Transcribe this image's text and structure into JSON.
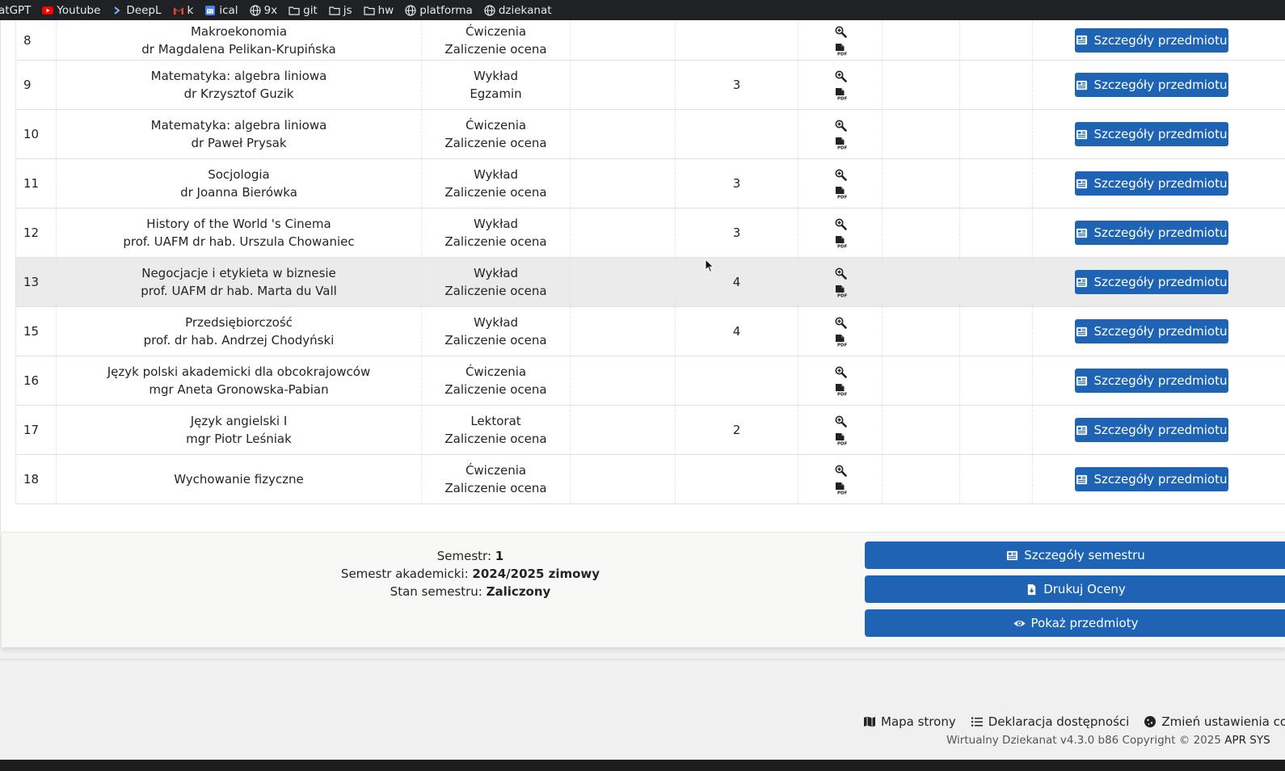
{
  "bookmarks": [
    {
      "label": "atGPT",
      "icon": "none"
    },
    {
      "label": "Youtube",
      "icon": "youtube-icon"
    },
    {
      "label": "DeepL",
      "icon": "deepl-icon"
    },
    {
      "label": "k",
      "icon": "gmail-icon"
    },
    {
      "label": "ical",
      "icon": "calendar-icon"
    },
    {
      "label": "9x",
      "icon": "globe-icon"
    },
    {
      "label": "git",
      "icon": "folder-icon"
    },
    {
      "label": "js",
      "icon": "folder-icon"
    },
    {
      "label": "hw",
      "icon": "folder-icon"
    },
    {
      "label": "platforma",
      "icon": "globe-icon"
    },
    {
      "label": "dziekanat",
      "icon": "globe-icon"
    }
  ],
  "table": {
    "details_label": "Szczegóły przedmiotu",
    "rows": [
      {
        "num": "8",
        "subject": "Makroekonomia",
        "teacher": "dr Magdalena Pelikan-Krupińska",
        "form": "Ćwiczenia",
        "assessment": "Zaliczenie ocena",
        "ects": ""
      },
      {
        "num": "9",
        "subject": "Matematyka: algebra liniowa",
        "teacher": "dr Krzysztof Guzik",
        "form": "Wykład",
        "assessment": "Egzamin",
        "ects": "3"
      },
      {
        "num": "10",
        "subject": "Matematyka: algebra liniowa",
        "teacher": "dr Paweł Prysak",
        "form": "Ćwiczenia",
        "assessment": "Zaliczenie ocena",
        "ects": ""
      },
      {
        "num": "11",
        "subject": "Socjologia",
        "teacher": "dr Joanna Bierówka",
        "form": "Wykład",
        "assessment": "Zaliczenie ocena",
        "ects": "3"
      },
      {
        "num": "12",
        "subject": "History of the World 's Cinema",
        "teacher": "prof. UAFM dr hab. Urszula Chowaniec",
        "form": "Wykład",
        "assessment": "Zaliczenie ocena",
        "ects": "3"
      },
      {
        "num": "13",
        "subject": "Negocjacje i etykieta w biznesie",
        "teacher": "prof. UAFM dr hab. Marta du Vall",
        "form": "Wykład",
        "assessment": "Zaliczenie ocena",
        "ects": "4"
      },
      {
        "num": "15",
        "subject": "Przedsiębiorczość",
        "teacher": "prof. dr hab. Andrzej Chodyński",
        "form": "Wykład",
        "assessment": "Zaliczenie ocena",
        "ects": "4"
      },
      {
        "num": "16",
        "subject": "Język polski akademicki dla obcokrajowców",
        "teacher": "mgr Aneta Gronowska-Pabian",
        "form": "Ćwiczenia",
        "assessment": "Zaliczenie ocena",
        "ects": ""
      },
      {
        "num": "17",
        "subject": "Język angielski I",
        "teacher": "mgr Piotr Leśniak",
        "form": "Lektorat",
        "assessment": "Zaliczenie ocena",
        "ects": "2"
      },
      {
        "num": "18",
        "subject": "Wychowanie fizyczne",
        "teacher": "",
        "form": "Ćwiczenia",
        "assessment": "Zaliczenie ocena",
        "ects": ""
      }
    ]
  },
  "semester": {
    "semester_label": "Semestr:",
    "semester_value": "1",
    "academic_label": "Semestr akademicki:",
    "academic_value": "2024/2025 zimowy",
    "status_label": "Stan semestru:",
    "status_value": "Zaliczony",
    "buttons": {
      "details": "Szczegóły semestru",
      "print": "Drukuj Oceny",
      "show": "Pokaż przedmioty"
    }
  },
  "footer": {
    "sitemap": "Mapa strony",
    "accessibility": "Deklaracja dostępności",
    "cookies": "Zmień ustawienia coo",
    "copyright_prefix": "Wirtualny Dziekanat v4.3.0 b86 Copyright © 2025",
    "copyright_company": "APR SYS"
  },
  "colors": {
    "primary": "#1f64b4",
    "bookmark_bar": "#202124",
    "highlight_row": "#ebebeb"
  }
}
